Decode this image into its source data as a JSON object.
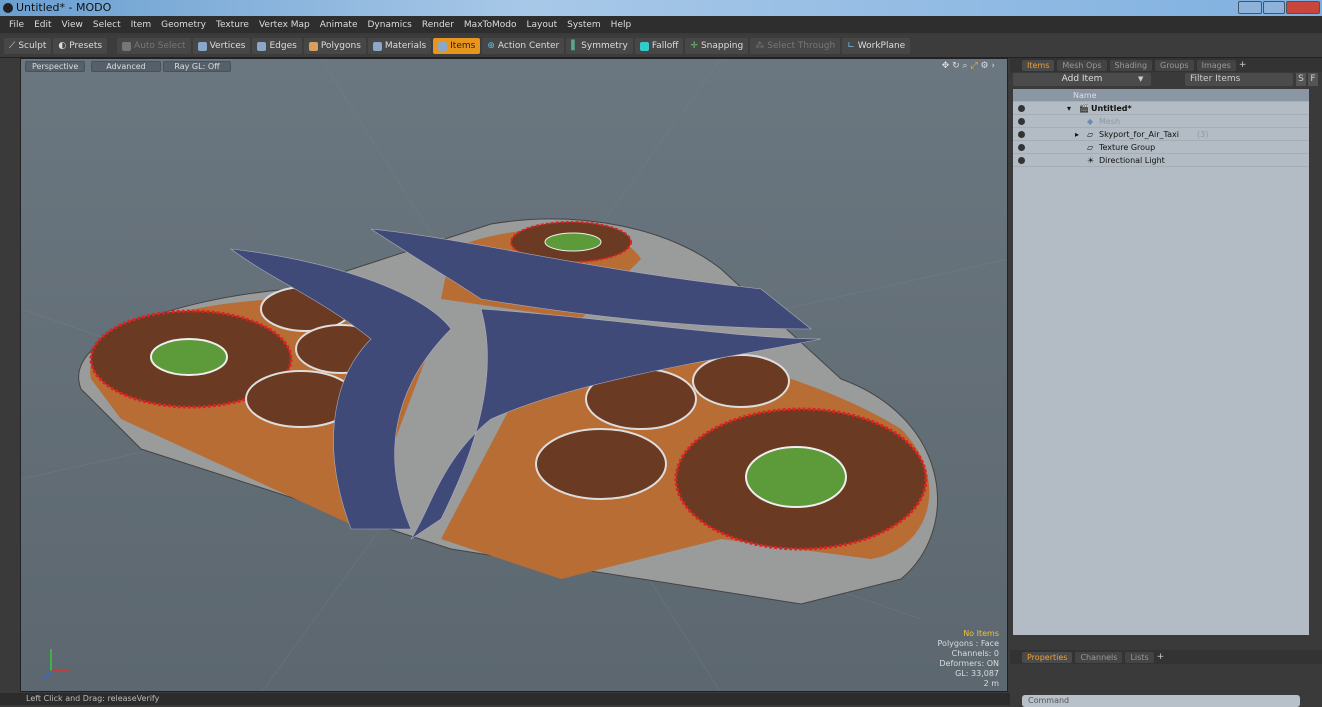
{
  "window": {
    "title": "Untitled* - MODO"
  },
  "menu": [
    "File",
    "Edit",
    "View",
    "Select",
    "Item",
    "Geometry",
    "Texture",
    "Vertex Map",
    "Animate",
    "Dynamics",
    "Render",
    "MaxToModo",
    "Layout",
    "System",
    "Help"
  ],
  "toolbar": {
    "sculpt": "Sculpt",
    "presets": "Presets",
    "auto_select": "Auto Select",
    "vertices": "Vertices",
    "edges": "Edges",
    "polygons": "Polygons",
    "materials": "Materials",
    "items": "Items",
    "action_center": "Action Center",
    "symmetry": "Symmetry",
    "falloff": "Falloff",
    "snapping": "Snapping",
    "select_through": "Select Through",
    "workplane": "WorkPlane",
    "accent": "#e8951e"
  },
  "viewport": {
    "view": "Perspective",
    "mode": "Advanced",
    "raygl": "Ray GL: Off",
    "stats": {
      "selection": "No Items",
      "polygons": "Polygons : Face",
      "channels": "Channels: 0",
      "deformers": "Deformers: ON",
      "gl": "GL: 33,087",
      "scale": "2 m"
    }
  },
  "status": "Left Click and Drag:  releaseVerify",
  "items_panel": {
    "tabs": [
      "Items",
      "Mesh Ops",
      "Shading",
      "Groups",
      "Images"
    ],
    "add_item": "Add Item",
    "filter": "Filter Items",
    "s": "S",
    "f": "F",
    "column": "Name",
    "rows": [
      {
        "name": "Untitled*",
        "extra": ""
      },
      {
        "name": "Mesh",
        "extra": ""
      },
      {
        "name": "Skyport_for_Air_Taxi",
        "extra": "(3)"
      },
      {
        "name": "Texture Group",
        "extra": ""
      },
      {
        "name": "Directional Light",
        "extra": ""
      }
    ]
  },
  "properties_panel": {
    "tabs": [
      "Properties",
      "Channels",
      "Lists"
    ]
  },
  "command": {
    "placeholder": "Command"
  }
}
